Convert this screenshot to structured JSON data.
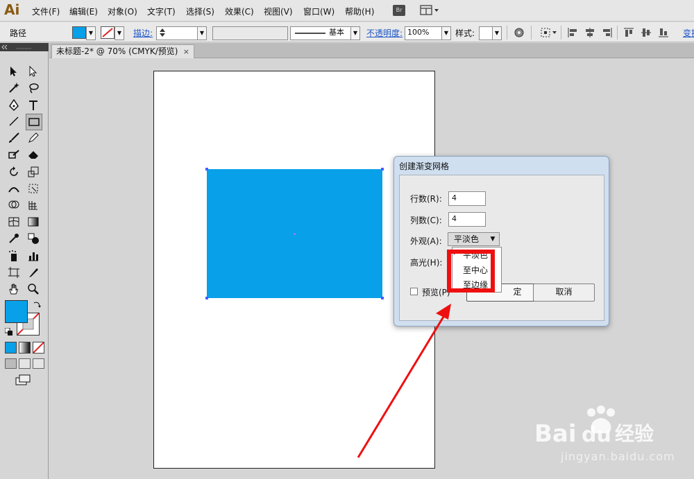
{
  "app": {
    "logo": "Ai"
  },
  "menu": [
    "文件(F)",
    "编辑(E)",
    "对象(O)",
    "文字(T)",
    "选择(S)",
    "效果(C)",
    "视图(V)",
    "窗口(W)",
    "帮助(H)"
  ],
  "menu_extra": {
    "bridge": "Br"
  },
  "control": {
    "selection_label": "路径",
    "stroke_label": "描边:",
    "profile_label": "基本",
    "opacity_label": "不透明度:",
    "opacity_value": "100%",
    "style_label": "样式:",
    "transform_label": "变换",
    "fill_color": "#08a0e8"
  },
  "document": {
    "tab_title": "未标题-2* @ 70% (CMYK/预览)",
    "close": "×"
  },
  "artwork": {
    "rect_color": "#08a0e8"
  },
  "dialog": {
    "title": "创建渐变网格",
    "rows_label": "行数(R):",
    "rows_value": "4",
    "cols_label": "列数(C):",
    "cols_value": "4",
    "appearance_label": "外观(A):",
    "appearance_value": "平淡色",
    "highlight_label": "高光(H):",
    "preview_label": "预览(P)",
    "ok_label": "确定",
    "ok_visible_fragment": "定",
    "cancel_label": "取消",
    "appearance_options": [
      "平淡色",
      "至中心",
      "至边缘"
    ]
  },
  "annotation": {
    "highlight_color": "#ee1010"
  },
  "watermark": {
    "brand": "Baidu经验",
    "url": "jingyan.baidu.com"
  }
}
